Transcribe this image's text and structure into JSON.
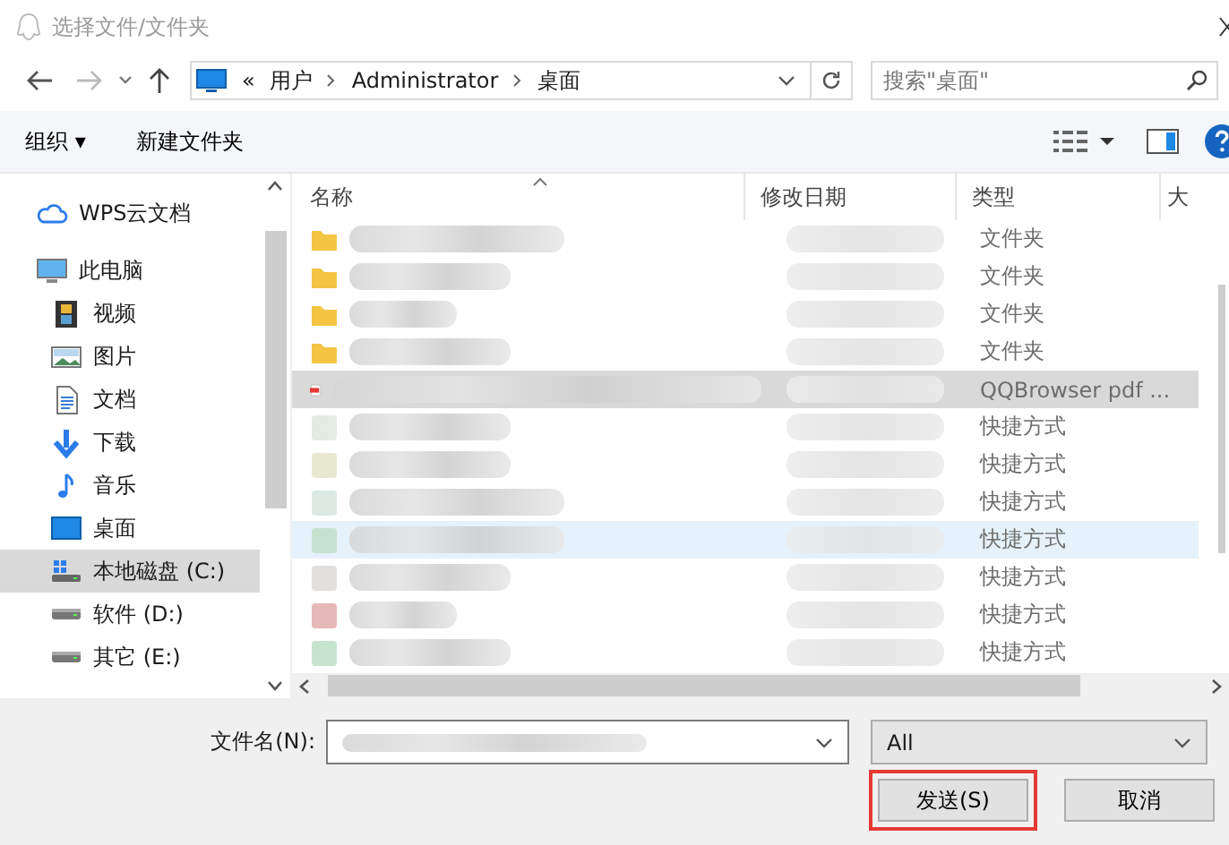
{
  "window": {
    "title": "选择文件/文件夹"
  },
  "address": {
    "crumbs": [
      "«",
      "用户",
      "Administrator",
      "桌面"
    ]
  },
  "search": {
    "placeholder": "搜索\"桌面\""
  },
  "toolbar": {
    "items": [
      "组织 ▾",
      "新建文件夹"
    ]
  },
  "sidebar": {
    "items": [
      {
        "label": "WPS云文档",
        "kind": "cloud",
        "selected": false
      },
      {
        "label": "此电脑",
        "kind": "pc",
        "selected": false,
        "children": [
          {
            "label": "视频",
            "kind": "video",
            "selected": false
          },
          {
            "label": "图片",
            "kind": "image",
            "selected": false
          },
          {
            "label": "文档",
            "kind": "doc",
            "selected": false
          },
          {
            "label": "下载",
            "kind": "download",
            "selected": false
          },
          {
            "label": "音乐",
            "kind": "music",
            "selected": false
          },
          {
            "label": "桌面",
            "kind": "desktop",
            "selected": false
          },
          {
            "label": "本地磁盘 (C:)",
            "kind": "sysdrive",
            "selected": true
          },
          {
            "label": "软件 (D:)",
            "kind": "drive",
            "selected": false
          },
          {
            "label": "其它 (E:)",
            "kind": "drive",
            "selected": false
          }
        ]
      }
    ]
  },
  "table": {
    "columns": [
      "名称",
      "修改日期",
      "类型",
      "大"
    ],
    "rows": [
      {
        "kind": "folder",
        "type": "文件夹",
        "selected": false,
        "hovered": false
      },
      {
        "kind": "folder",
        "type": "文件夹",
        "selected": false,
        "hovered": false
      },
      {
        "kind": "folder",
        "type": "文件夹",
        "selected": false,
        "hovered": false
      },
      {
        "kind": "folder",
        "type": "文件夹",
        "selected": false,
        "hovered": false
      },
      {
        "kind": "pdf",
        "type": "QQBrowser pdf ...",
        "selected": true,
        "hovered": false
      },
      {
        "kind": "shortcut",
        "type": "快捷方式",
        "selected": false,
        "hovered": false
      },
      {
        "kind": "shortcut",
        "type": "快捷方式",
        "selected": false,
        "hovered": false
      },
      {
        "kind": "shortcut",
        "type": "快捷方式",
        "selected": false,
        "hovered": false
      },
      {
        "kind": "shortcut",
        "type": "快捷方式",
        "selected": false,
        "hovered": true
      },
      {
        "kind": "shortcut",
        "type": "快捷方式",
        "selected": false,
        "hovered": false
      },
      {
        "kind": "shortcut",
        "type": "快捷方式",
        "selected": false,
        "hovered": false
      },
      {
        "kind": "shortcut",
        "type": "快捷方式",
        "selected": false,
        "hovered": false
      }
    ]
  },
  "filename": {
    "label": "文件名(N):"
  },
  "filter": {
    "value": "All"
  },
  "buttons": [
    {
      "label": "发送(S)",
      "highlighted": true
    },
    {
      "label": "取消",
      "highlighted": false
    }
  ]
}
